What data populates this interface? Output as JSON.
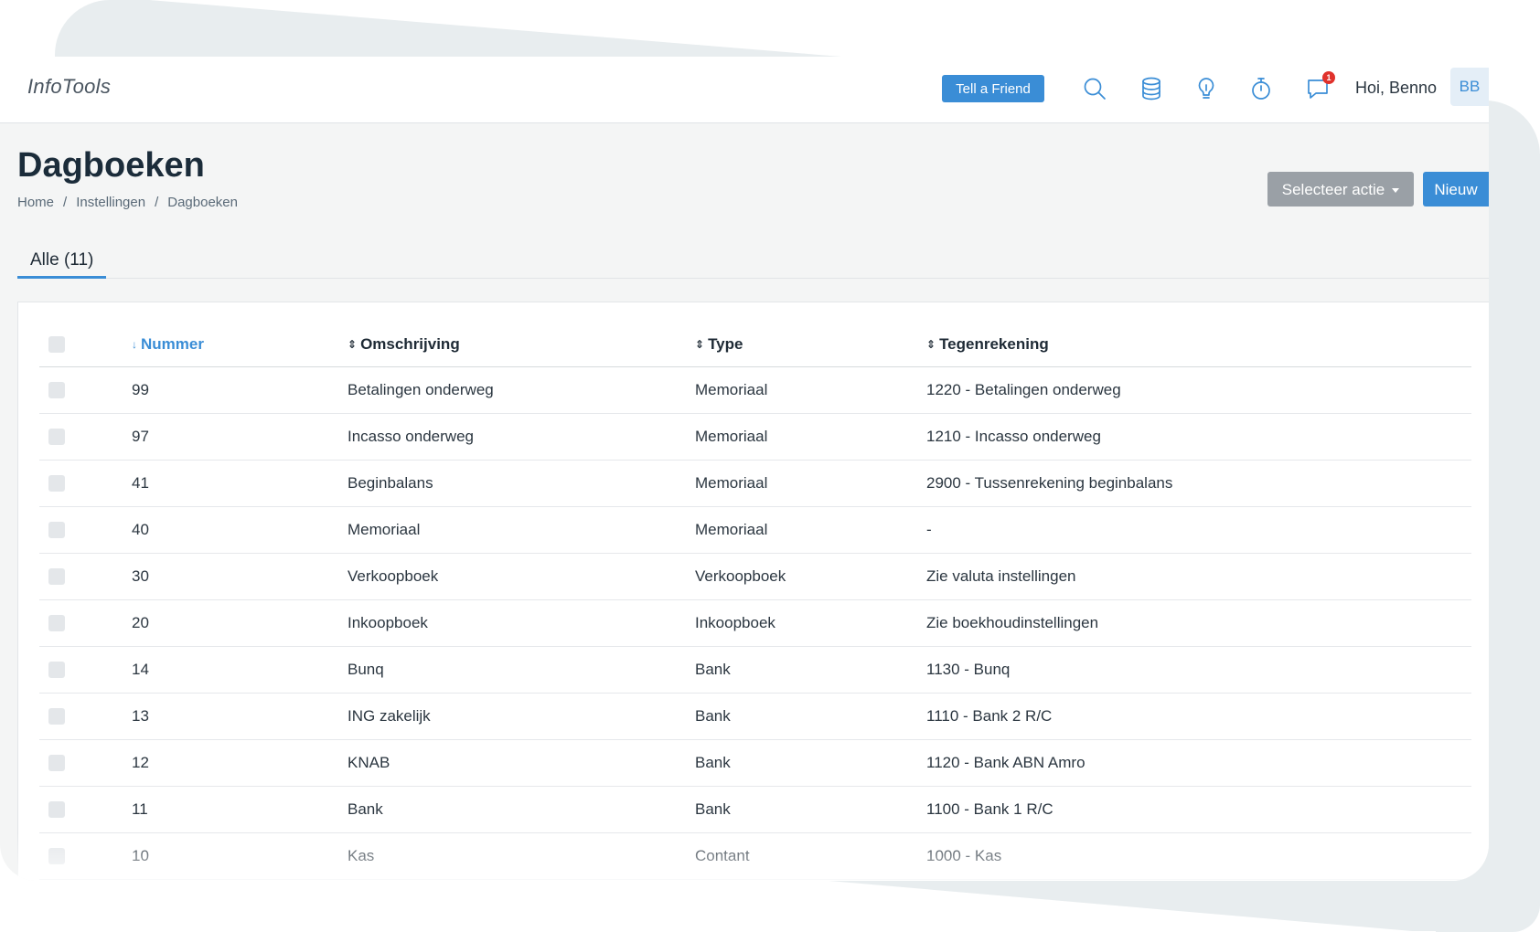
{
  "app": {
    "brand": "InfoTools"
  },
  "header": {
    "tell_a_friend": "Tell a Friend",
    "notification_count": "1",
    "greeting": "Hoi, Benno",
    "avatar_initials": "BB"
  },
  "page": {
    "title": "Dagboeken",
    "breadcrumb": [
      "Home",
      "Instellingen",
      "Dagboeken"
    ],
    "action_button": "Selecteer actie",
    "new_button": "Nieuw",
    "tab_all": "Alle (11)"
  },
  "table": {
    "columns": [
      "Nummer",
      "Omschrijving",
      "Type",
      "Tegenrekening"
    ],
    "sorted_column": "Nummer",
    "rows": [
      [
        "99",
        "Betalingen onderweg",
        "Memoriaal",
        "1220 - Betalingen onderweg"
      ],
      [
        "97",
        "Incasso onderweg",
        "Memoriaal",
        "1210 - Incasso onderweg"
      ],
      [
        "41",
        "Beginbalans",
        "Memoriaal",
        "2900 - Tussenrekening beginbalans"
      ],
      [
        "40",
        "Memoriaal",
        "Memoriaal",
        "-"
      ],
      [
        "30",
        "Verkoopboek",
        "Verkoopboek",
        "Zie valuta instellingen"
      ],
      [
        "20",
        "Inkoopboek",
        "Inkoopboek",
        "Zie boekhoudinstellingen"
      ],
      [
        "14",
        "Bunq",
        "Bank",
        "1130 - Bunq"
      ],
      [
        "13",
        "ING zakelijk",
        "Bank",
        "1110 - Bank 2 R/C"
      ],
      [
        "12",
        "KNAB",
        "Bank",
        "1120 - Bank ABN Amro"
      ],
      [
        "11",
        "Bank",
        "Bank",
        "1100 - Bank 1 R/C"
      ],
      [
        "10",
        "Kas",
        "Contant",
        "1000 - Kas"
      ]
    ]
  },
  "colors": {
    "accent": "#3a8dd6",
    "badge": "#e0322c",
    "muted_button": "#9aa0a6"
  },
  "icons": [
    "search-icon",
    "database-icon",
    "lightbulb-icon",
    "stopwatch-icon",
    "chat-icon"
  ]
}
